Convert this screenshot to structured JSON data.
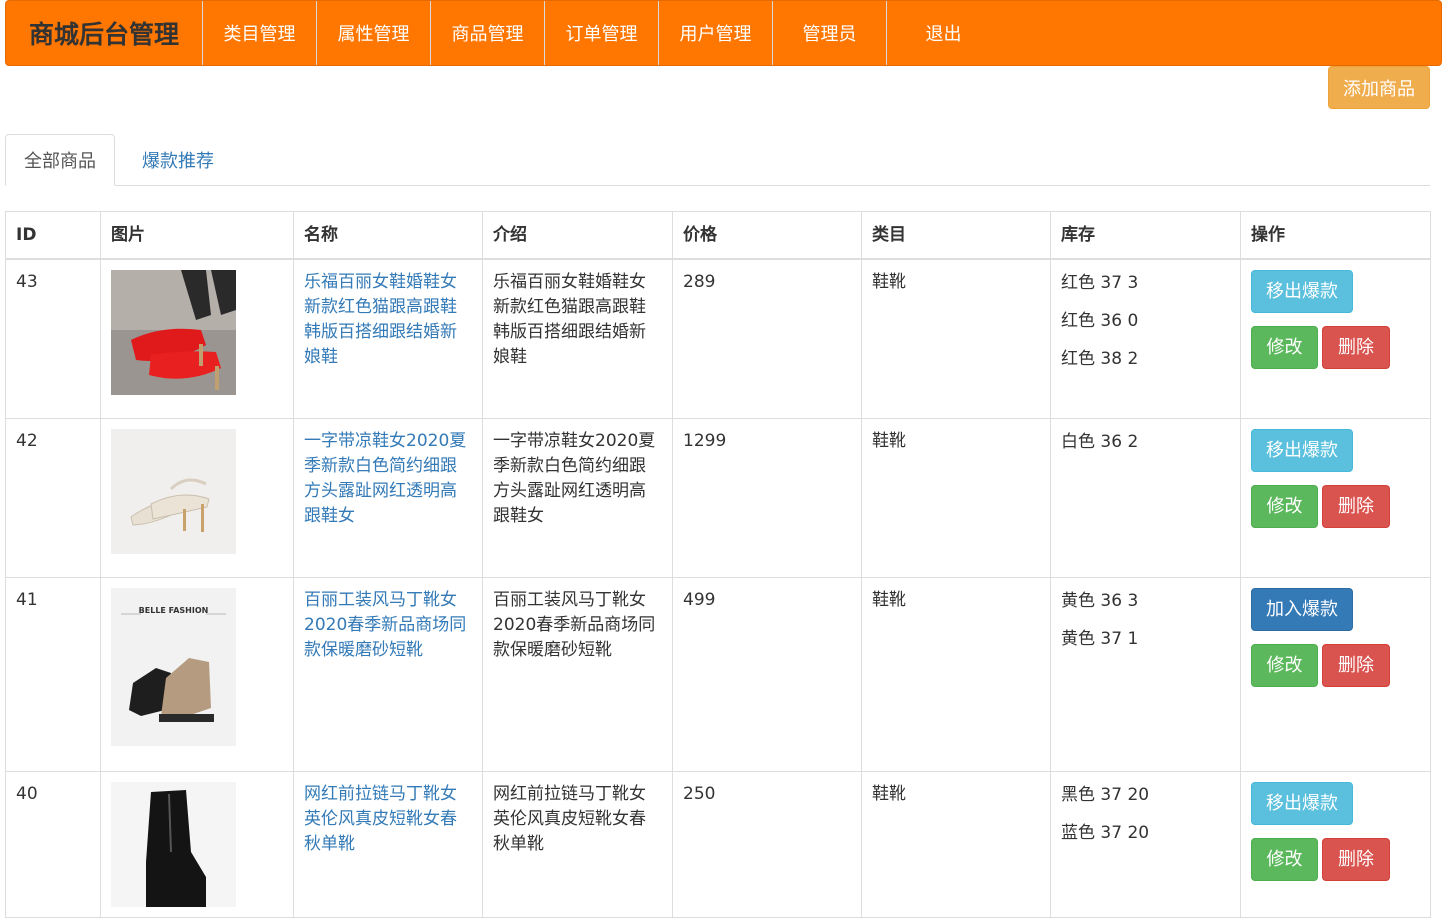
{
  "brand": "商城后台管理",
  "nav": [
    "类目管理",
    "属性管理",
    "商品管理",
    "订单管理",
    "用户管理",
    "管理员",
    "退出"
  ],
  "add_button": "添加商品",
  "tabs": [
    "全部商品",
    "爆款推荐"
  ],
  "table": {
    "headers": [
      "ID",
      "图片",
      "名称",
      "介绍",
      "价格",
      "类目",
      "库存",
      "操作"
    ],
    "rows": [
      {
        "id": "43",
        "name": "乐福百丽女鞋婚鞋女新款红色猫跟高跟鞋韩版百搭细跟结婚新娘鞋",
        "intro": "乐福百丽女鞋婚鞋女新款红色猫跟高跟鞋韩版百搭细跟结婚新娘鞋",
        "price": "289",
        "category": "鞋靴",
        "stock": [
          "红色 37 3",
          "红色 36 0",
          "红色 38 2"
        ],
        "hot_action": "移出爆款",
        "hot_style": "info",
        "edit": "修改",
        "delete": "删除",
        "image_icon": "red-heels-image"
      },
      {
        "id": "42",
        "name": "一字带凉鞋女2020夏季新款白色简约细跟方头露趾网红透明高跟鞋女",
        "intro": "一字带凉鞋女2020夏季新款白色简约细跟方头露趾网红透明高跟鞋女",
        "price": "1299",
        "category": "鞋靴",
        "stock": [
          "白色 36 2"
        ],
        "hot_action": "移出爆款",
        "hot_style": "info",
        "edit": "修改",
        "delete": "删除",
        "image_icon": "white-sandals-image"
      },
      {
        "id": "41",
        "name": "百丽工装风马丁靴女2020春季新品商场同款保暖磨砂短靴",
        "intro": "百丽工装风马丁靴女2020春季新品商场同款保暖磨砂短靴",
        "price": "499",
        "category": "鞋靴",
        "stock": [
          "黄色 36 3",
          "黄色 37 1"
        ],
        "hot_action": "加入爆款",
        "hot_style": "primary",
        "edit": "修改",
        "delete": "删除",
        "image_icon": "martin-boots-image",
        "image_text": "BELLE FASHION"
      },
      {
        "id": "40",
        "name": "网红前拉链马丁靴女英伦风真皮短靴女春秋单靴",
        "intro": "网红前拉链马丁靴女英伦风真皮短靴女春秋单靴",
        "price": "250",
        "category": "鞋靴",
        "stock": [
          "黑色 37 20",
          "蓝色 37 20"
        ],
        "hot_action": "移出爆款",
        "hot_style": "info",
        "edit": "修改",
        "delete": "删除",
        "image_icon": "black-boots-image"
      }
    ]
  },
  "colors": {
    "navbar": "#ff7700",
    "link": "#337ab7",
    "warning": "#f0ad4e",
    "info": "#5bc0de",
    "primary": "#337ab7",
    "success": "#5cb85c",
    "danger": "#d9534f"
  }
}
